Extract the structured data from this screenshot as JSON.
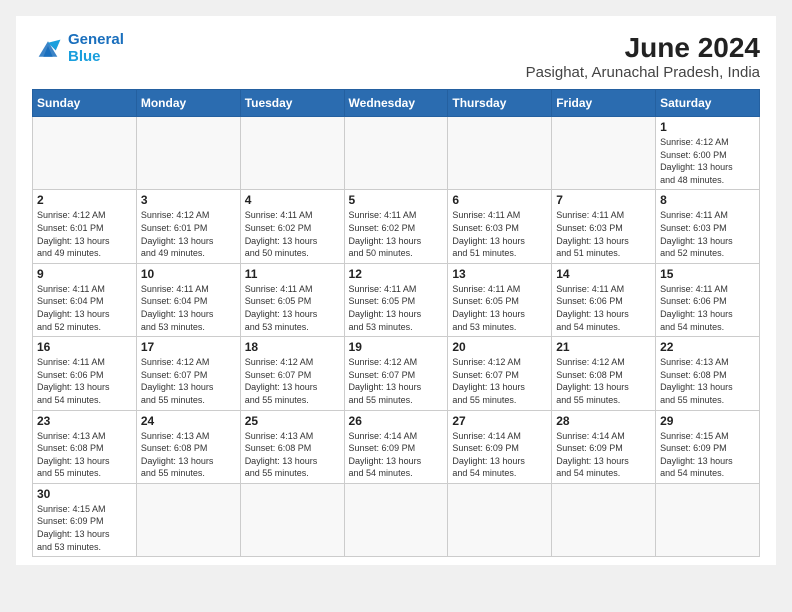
{
  "header": {
    "logo_general": "General",
    "logo_blue": "Blue",
    "month_year": "June 2024",
    "location": "Pasighat, Arunachal Pradesh, India"
  },
  "weekdays": [
    "Sunday",
    "Monday",
    "Tuesday",
    "Wednesday",
    "Thursday",
    "Friday",
    "Saturday"
  ],
  "weeks": [
    [
      {
        "day": "",
        "info": ""
      },
      {
        "day": "",
        "info": ""
      },
      {
        "day": "",
        "info": ""
      },
      {
        "day": "",
        "info": ""
      },
      {
        "day": "",
        "info": ""
      },
      {
        "day": "",
        "info": ""
      },
      {
        "day": "1",
        "info": "Sunrise: 4:12 AM\nSunset: 6:00 PM\nDaylight: 13 hours\nand 48 minutes."
      }
    ],
    [
      {
        "day": "2",
        "info": "Sunrise: 4:12 AM\nSunset: 6:01 PM\nDaylight: 13 hours\nand 49 minutes."
      },
      {
        "day": "3",
        "info": "Sunrise: 4:12 AM\nSunset: 6:01 PM\nDaylight: 13 hours\nand 49 minutes."
      },
      {
        "day": "4",
        "info": "Sunrise: 4:11 AM\nSunset: 6:02 PM\nDaylight: 13 hours\nand 50 minutes."
      },
      {
        "day": "5",
        "info": "Sunrise: 4:11 AM\nSunset: 6:02 PM\nDaylight: 13 hours\nand 50 minutes."
      },
      {
        "day": "6",
        "info": "Sunrise: 4:11 AM\nSunset: 6:03 PM\nDaylight: 13 hours\nand 51 minutes."
      },
      {
        "day": "7",
        "info": "Sunrise: 4:11 AM\nSunset: 6:03 PM\nDaylight: 13 hours\nand 51 minutes."
      },
      {
        "day": "8",
        "info": "Sunrise: 4:11 AM\nSunset: 6:03 PM\nDaylight: 13 hours\nand 52 minutes."
      }
    ],
    [
      {
        "day": "9",
        "info": "Sunrise: 4:11 AM\nSunset: 6:04 PM\nDaylight: 13 hours\nand 52 minutes."
      },
      {
        "day": "10",
        "info": "Sunrise: 4:11 AM\nSunset: 6:04 PM\nDaylight: 13 hours\nand 53 minutes."
      },
      {
        "day": "11",
        "info": "Sunrise: 4:11 AM\nSunset: 6:05 PM\nDaylight: 13 hours\nand 53 minutes."
      },
      {
        "day": "12",
        "info": "Sunrise: 4:11 AM\nSunset: 6:05 PM\nDaylight: 13 hours\nand 53 minutes."
      },
      {
        "day": "13",
        "info": "Sunrise: 4:11 AM\nSunset: 6:05 PM\nDaylight: 13 hours\nand 53 minutes."
      },
      {
        "day": "14",
        "info": "Sunrise: 4:11 AM\nSunset: 6:06 PM\nDaylight: 13 hours\nand 54 minutes."
      },
      {
        "day": "15",
        "info": "Sunrise: 4:11 AM\nSunset: 6:06 PM\nDaylight: 13 hours\nand 54 minutes."
      }
    ],
    [
      {
        "day": "16",
        "info": "Sunrise: 4:11 AM\nSunset: 6:06 PM\nDaylight: 13 hours\nand 54 minutes."
      },
      {
        "day": "17",
        "info": "Sunrise: 4:12 AM\nSunset: 6:07 PM\nDaylight: 13 hours\nand 55 minutes."
      },
      {
        "day": "18",
        "info": "Sunrise: 4:12 AM\nSunset: 6:07 PM\nDaylight: 13 hours\nand 55 minutes."
      },
      {
        "day": "19",
        "info": "Sunrise: 4:12 AM\nSunset: 6:07 PM\nDaylight: 13 hours\nand 55 minutes."
      },
      {
        "day": "20",
        "info": "Sunrise: 4:12 AM\nSunset: 6:07 PM\nDaylight: 13 hours\nand 55 minutes."
      },
      {
        "day": "21",
        "info": "Sunrise: 4:12 AM\nSunset: 6:08 PM\nDaylight: 13 hours\nand 55 minutes."
      },
      {
        "day": "22",
        "info": "Sunrise: 4:13 AM\nSunset: 6:08 PM\nDaylight: 13 hours\nand 55 minutes."
      }
    ],
    [
      {
        "day": "23",
        "info": "Sunrise: 4:13 AM\nSunset: 6:08 PM\nDaylight: 13 hours\nand 55 minutes."
      },
      {
        "day": "24",
        "info": "Sunrise: 4:13 AM\nSunset: 6:08 PM\nDaylight: 13 hours\nand 55 minutes."
      },
      {
        "day": "25",
        "info": "Sunrise: 4:13 AM\nSunset: 6:08 PM\nDaylight: 13 hours\nand 55 minutes."
      },
      {
        "day": "26",
        "info": "Sunrise: 4:14 AM\nSunset: 6:09 PM\nDaylight: 13 hours\nand 54 minutes."
      },
      {
        "day": "27",
        "info": "Sunrise: 4:14 AM\nSunset: 6:09 PM\nDaylight: 13 hours\nand 54 minutes."
      },
      {
        "day": "28",
        "info": "Sunrise: 4:14 AM\nSunset: 6:09 PM\nDaylight: 13 hours\nand 54 minutes."
      },
      {
        "day": "29",
        "info": "Sunrise: 4:15 AM\nSunset: 6:09 PM\nDaylight: 13 hours\nand 54 minutes."
      }
    ],
    [
      {
        "day": "30",
        "info": "Sunrise: 4:15 AM\nSunset: 6:09 PM\nDaylight: 13 hours\nand 53 minutes."
      },
      {
        "day": "",
        "info": ""
      },
      {
        "day": "",
        "info": ""
      },
      {
        "day": "",
        "info": ""
      },
      {
        "day": "",
        "info": ""
      },
      {
        "day": "",
        "info": ""
      },
      {
        "day": "",
        "info": ""
      }
    ]
  ]
}
